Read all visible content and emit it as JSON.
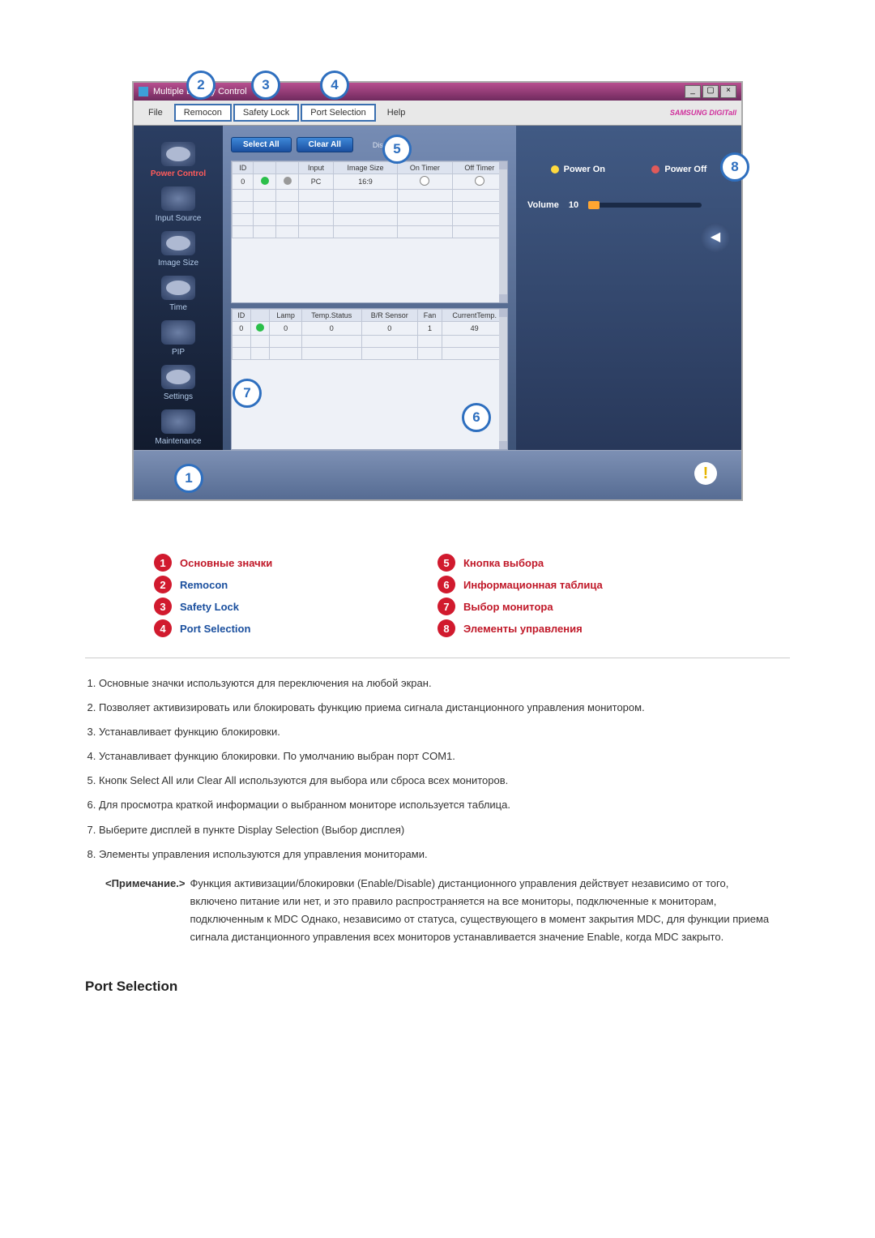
{
  "app": {
    "title": "Multiple Display Control",
    "menu": {
      "file": "File",
      "remocon": "Remocon",
      "safety_lock": "Safety Lock",
      "port_selection": "Port Selection",
      "help": "Help"
    },
    "brand": "SAMSUNG DIGITall",
    "toolbar": {
      "select_all": "Select All",
      "clear_all": "Clear All",
      "disable": "Disable"
    },
    "leftnav": {
      "power_control": "Power Control",
      "input_source": "Input Source",
      "image_size": "Image Size",
      "time": "Time",
      "pip": "PIP",
      "settings": "Settings",
      "maintenance": "Maintenance"
    },
    "table1": {
      "headers": {
        "id": "ID",
        "remocon": "",
        "safety": "",
        "input": "Input",
        "image_size": "Image Size",
        "on_timer": "On Timer",
        "off_timer": "Off Timer"
      },
      "row": {
        "id": "0",
        "input": "PC",
        "image_size": "16:9"
      }
    },
    "table2": {
      "headers": {
        "id": "ID",
        "remocon": "",
        "lamp": "Lamp",
        "temp": "Temp.Status",
        "br": "B/R Sensor",
        "fan": "Fan",
        "cur": "CurrentTemp."
      },
      "row": {
        "id": "0",
        "lamp": "0",
        "temp": "0",
        "br": "0",
        "fan": "1",
        "cur": "49"
      }
    },
    "right": {
      "power_on": "Power On",
      "power_off": "Power Off",
      "volume_label": "Volume",
      "volume_value": "10"
    }
  },
  "legend": {
    "i1": "Основные значки",
    "i2": "Remocon",
    "i3": "Safety Lock",
    "i4": "Port Selection",
    "i5": "Кнопка выбора",
    "i6": "Информационная таблица",
    "i7": "Выбор монитора",
    "i8": "Элементы управления"
  },
  "notes": {
    "n1": "Основные значки используются для переключения на любой экран.",
    "n2": "Позволяет активизировать или блокировать функцию приема сигнала дистанционного управления монитором.",
    "n3": "Устанавливает функцию блокировки.",
    "n4": "Устанавливает функцию блокировки. По умолчанию выбран порт COM1.",
    "n5": "Кнопк Select All или Clear All используются для выбора или сброса всех мониторов.",
    "n6": "Для просмотра краткой информации о выбранном мониторе используется таблица.",
    "n7": "Выберите дисплей в пункте Display Selection (Выбор дисплея)",
    "n8": "Элементы управления используются для управления мониторами.",
    "note_label": "<Примечание.>",
    "note_body": "Функция активизации/блокировки (Enable/Disable) дистанционного управления действует независимо от того, включено питание или нет, и это правило распространяется на все мониторы, подключенные к мониторам, подключенным к MDC Однако, независимо от статуса, существующего в момент закрытия MDC, для функции приема сигнала дистанционного управления всех мониторов устанавливается значение Enable, когда MDC закрыто."
  },
  "section_heading": "Port Selection"
}
